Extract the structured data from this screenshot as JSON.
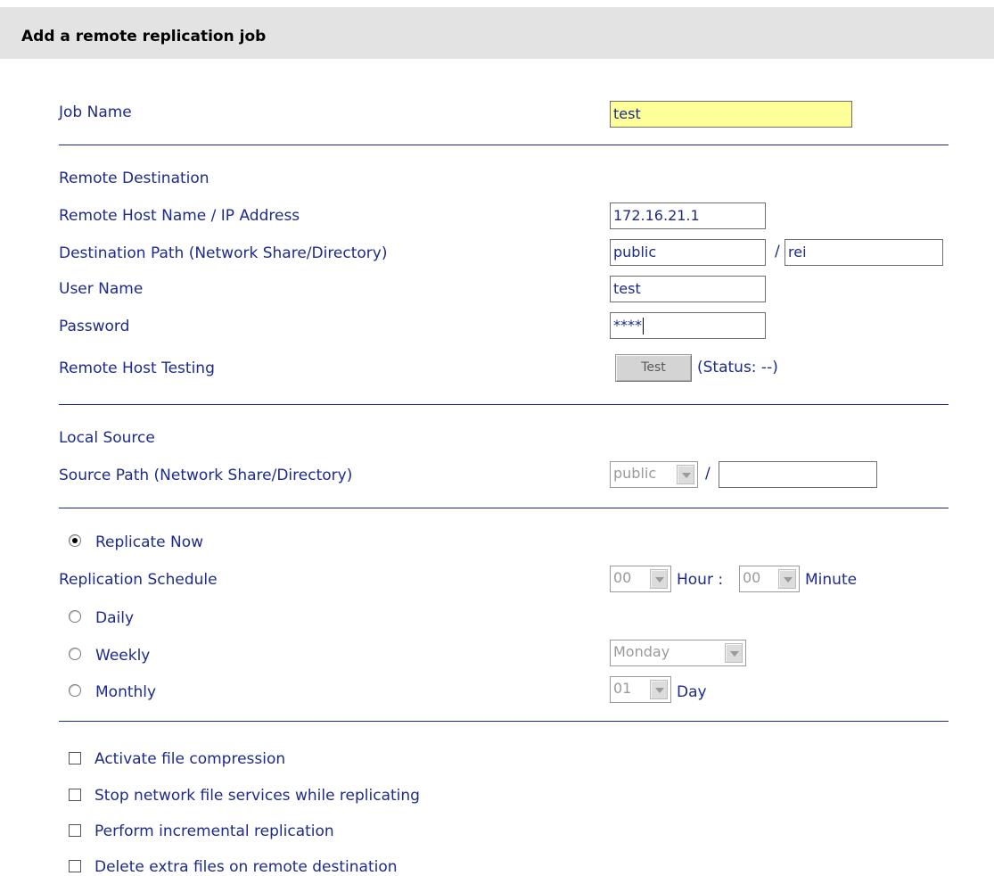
{
  "header": {
    "title": "Add a remote replication job"
  },
  "job": {
    "label": "Job Name",
    "value": "test"
  },
  "remote": {
    "section_label": "Remote Destination",
    "host_label": "Remote Host Name / IP Address",
    "host_value": "172.16.21.1",
    "path_label": "Destination Path (Network Share/Directory)",
    "share_value": "public",
    "slash": "/",
    "dir_value": "rei",
    "user_label": "User Name",
    "user_value": "test",
    "password_label": "Password",
    "password_value": "****",
    "testing_label": "Remote Host Testing",
    "test_button": "Test",
    "status_text": "(Status: --)"
  },
  "local": {
    "section_label": "Local Source",
    "path_label": "Source Path (Network Share/Directory)",
    "share_selected": "public",
    "slash": "/",
    "dir_value": ""
  },
  "schedule": {
    "now_label": "Replicate Now",
    "schedule_label": "Replication Schedule",
    "hour_value": "00",
    "hour_label": "Hour :",
    "minute_value": "00",
    "minute_label": "Minute",
    "daily_label": "Daily",
    "weekly_label": "Weekly",
    "weekday_value": "Monday",
    "monthly_label": "Monthly",
    "day_value": "01",
    "day_label": "Day",
    "selected": "now"
  },
  "options": [
    {
      "label": "Activate file compression",
      "checked": false
    },
    {
      "label": "Stop network file services while replicating",
      "checked": false
    },
    {
      "label": "Perform incremental replication",
      "checked": false
    },
    {
      "label": "Delete extra files on remote destination",
      "checked": false
    }
  ]
}
